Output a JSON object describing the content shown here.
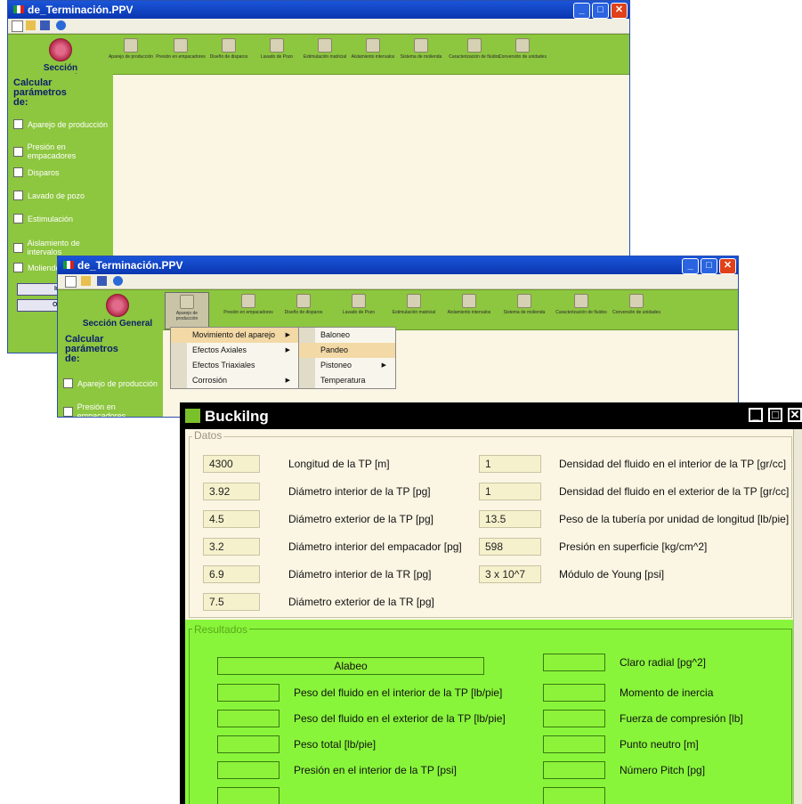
{
  "window1": {
    "title": "de_Terminación.PPV",
    "section_label": "Sección General",
    "ribbon_items": [
      "Aparejo de producción",
      "Presión en empacadores",
      "Diseño de disparos",
      "Lavado de Pozo",
      "Estimulación matricial",
      "Aislamiento intervalos",
      "Sistema de molienda",
      "Caracterización de fluidos",
      "Conversión de unidades"
    ],
    "panel_heading": "Calcular parámetros de:",
    "checkboxes": [
      "Aparejo de producción",
      "Presión en empacadores",
      "Disparos",
      "Lavado de pozo",
      "Estimulación",
      "Aislamiento de intervalos",
      "Moliendo"
    ],
    "buttons": [
      "Inici",
      "Ocult"
    ]
  },
  "window2": {
    "title": "de_Terminación.PPV",
    "section_label": "Sección General",
    "ribbon_items": [
      "Aparejo de producción",
      "Presión en empacadores",
      "Diseño de disparos",
      "Lavado de Pozo",
      "Estimulación matricial",
      "Aislamiento intervalos",
      "Sistema de molienda",
      "Caracterización de fluidos",
      "Conversión de unidades"
    ],
    "panel_heading": "Calcular parámetros de:",
    "checkboxes": [
      "Aparejo de producción",
      "Presión en empacadores"
    ],
    "menu": [
      "Movimiento del aparejo",
      "Efectos Axiales",
      "Efectos Triaxiales",
      "Corrosión"
    ],
    "submenu": [
      "Baloneo",
      "Pandeo",
      "Pistoneo",
      "Temperatura"
    ]
  },
  "buckling": {
    "title": "Buckilng",
    "datos_label": "Datos",
    "datos": [
      {
        "value": "4300",
        "label": "Longitud de la TP [m]"
      },
      {
        "value": "3.92",
        "label": "Diámetro interior de la TP [pg]"
      },
      {
        "value": "4.5",
        "label": "Diámetro exterior de la TP [pg]"
      },
      {
        "value": "3.2",
        "label": "Diámetro interior del empacador [pg]"
      },
      {
        "value": "6.9",
        "label": "Diámetro interior de la TR [pg]"
      },
      {
        "value": "7.5",
        "label": "Diámetro exterior de la TR [pg]"
      }
    ],
    "datos_right": [
      {
        "value": "1",
        "label": "Densidad del fluido en el interior de la TP [gr/cc]"
      },
      {
        "value": "1",
        "label": "Densidad del fluido en el exterior de la TP [gr/cc]"
      },
      {
        "value": "13.5",
        "label": "Peso de la tubería por unidad de longitud [lb/pie]"
      },
      {
        "value": "598",
        "label": "Presión en superficie [kg/cm^2]"
      },
      {
        "value": "3 x 10^7",
        "label": "Módulo de Young [psi]"
      }
    ],
    "resultados_label": "Resultados",
    "alabeo": "Alabeo",
    "results_left": [
      "Peso del fluido en el interior de la TP [lb/pie]",
      "Peso del fluido en el exterior de la TP [lb/pie]",
      "Peso total [lb/pie]",
      "Presión en el interior de la TP  [psi]"
    ],
    "results_right": [
      "Claro radial [pg^2]",
      "Momento de inercia",
      "Fuerza de compresión [lb]",
      "Punto neutro [m]",
      "Número Pitch [pg]"
    ]
  }
}
